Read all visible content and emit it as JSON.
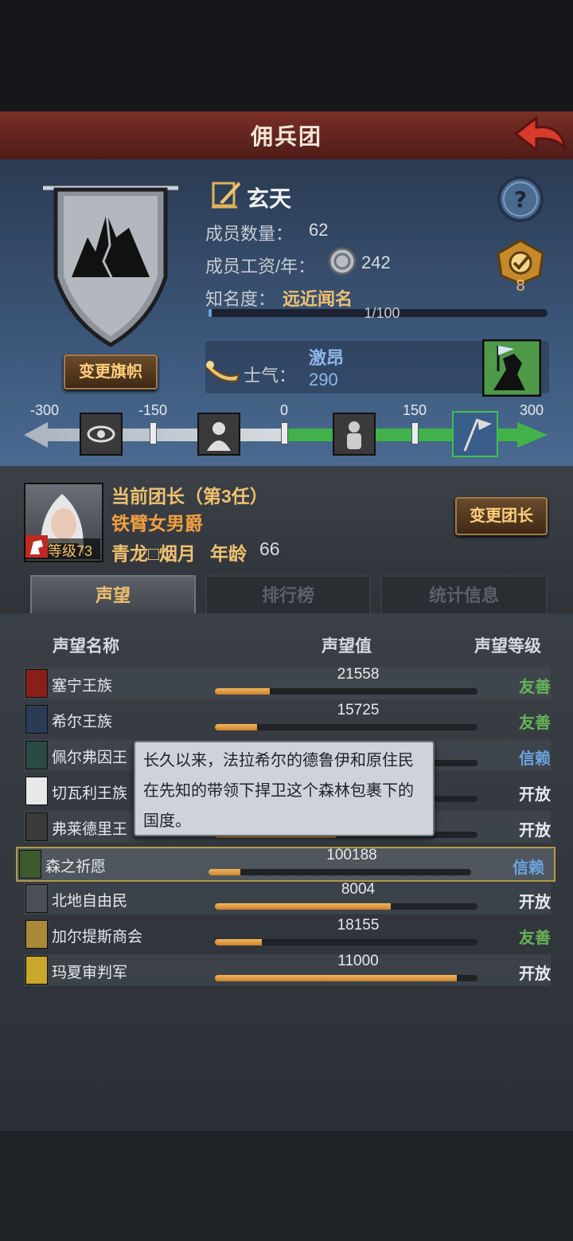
{
  "header": {
    "title": "佣兵团"
  },
  "company": {
    "name": "玄天",
    "members_label": "成员数量：",
    "members_value": "62",
    "wage_label": "成员工资/年：",
    "wage_value": "242",
    "fame_label": "知名度：",
    "fame_value": "远近闻名",
    "fame_progress": "1/100",
    "fame_fraction": 0.01,
    "badge_count": "8",
    "change_banner": "变更旗帜"
  },
  "morale": {
    "label": "士气：",
    "state": "激昂",
    "value": "290",
    "ticks": [
      "-300",
      "-150",
      "0",
      "150",
      "300"
    ],
    "level": 290
  },
  "leader": {
    "title": "当前团长（第3任）",
    "name": "铁臂女男爵",
    "level": "等级73",
    "origin": "青龙□烟月",
    "age_label": "年龄",
    "age": "66",
    "change_button": "变更团长"
  },
  "tabs": [
    {
      "label": "声望"
    },
    {
      "label": "排行榜"
    },
    {
      "label": "统计信息"
    }
  ],
  "table": {
    "columns": [
      "声望名称",
      "声望值",
      "声望等级"
    ],
    "rows": [
      {
        "name": "塞宁王族",
        "value": "21558",
        "level": "友善",
        "progress": 0.21,
        "color": "#66b35a"
      },
      {
        "name": "希尔王族",
        "value": "15725",
        "level": "友善",
        "progress": 0.16,
        "color": "#66b35a"
      },
      {
        "name": "佩尔弗因王",
        "value": "",
        "level": "信赖",
        "progress": 0.5,
        "color": "#6aa3e0"
      },
      {
        "name": "切瓦利王族",
        "value": "",
        "level": "开放",
        "progress": 0.5,
        "color": "#e8eaee"
      },
      {
        "name": "弗莱德里王",
        "value": "",
        "level": "开放",
        "progress": 0.46,
        "color": "#e8eaee"
      },
      {
        "name": "森之祈愿",
        "value": "100188",
        "level": "信赖",
        "progress": 0.12,
        "color": "#6aa3e0"
      },
      {
        "name": "北地自由民",
        "value": "8004",
        "level": "开放",
        "progress": 0.67,
        "color": "#e8eaee"
      },
      {
        "name": "加尔提斯商会",
        "value": "18155",
        "level": "友善",
        "progress": 0.18,
        "color": "#66b35a"
      },
      {
        "name": "玛夏审判军",
        "value": "11000",
        "level": "开放",
        "progress": 0.92,
        "color": "#e8eaee"
      }
    ]
  },
  "tooltip": {
    "text": "长久以来，法拉希尔的德鲁伊和原住民在先知的带领下捍卫这个森林包裹下的国度。"
  },
  "icons": [
    "back-arrow-icon",
    "quill-icon",
    "silver-coin-icon",
    "help-icon",
    "target-badge-icon",
    "horn-icon",
    "flag-warrior-icon"
  ]
}
